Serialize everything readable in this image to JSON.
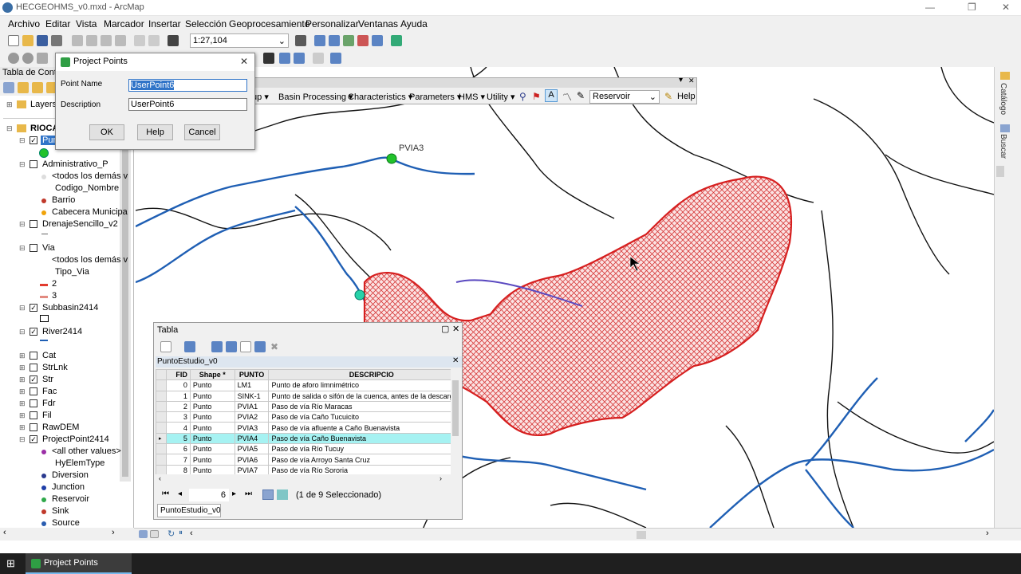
{
  "window": {
    "title": "HECGEOHMS_v0.mxd - ArcMap"
  },
  "menu": [
    "Archivo",
    "Editar",
    "Vista",
    "Marcador",
    "Insertar",
    "Selección",
    "Geoprocesamiento",
    "Personalizar",
    "Ventanas",
    "Ayuda"
  ],
  "toolbar": {
    "scale": "1:27,104"
  },
  "toc": {
    "title": "Tabla de Conte",
    "layers_label": "Layers",
    "root": "RIOCA",
    "pun": "Pun",
    "items": [
      "Administrativo_P",
      "<todos los demás v",
      "Codigo_Nombre",
      "Barrio",
      "Cabecera Municipa",
      "DrenajeSencillo_v2",
      "Via",
      "<todos los demás v",
      "Tipo_Via",
      "2",
      "3",
      "Subbasin2414",
      "River2414",
      "Cat",
      "StrLnk",
      "Str",
      "Fac",
      "Fdr",
      "Fil",
      "RawDEM",
      "ProjectPoint2414",
      "<all other values>",
      "HyElemType",
      "Diversion",
      "Junction",
      "Reservoir",
      "Sink",
      "Source"
    ]
  },
  "hydro": {
    "items": [
      "tup",
      "Basin Processing",
      "Characteristics",
      "Parameters",
      "HMS",
      "Utility"
    ],
    "reservoir": "Reservoir",
    "help": "Help"
  },
  "dialog": {
    "title": "Project Points",
    "point_name_label": "Point Name",
    "point_name_value": "UserPoint6",
    "description_label": "Description",
    "description_value": "UserPoint6",
    "ok": "OK",
    "help": "Help",
    "cancel": "Cancel"
  },
  "map": {
    "label_pvia3": "PVIA3"
  },
  "tabla": {
    "title": "Tabla",
    "subtitle": "PuntoEstudio_v0",
    "columns": [
      "FID",
      "Shape *",
      "PUNTO",
      "DESCRIPCIO"
    ],
    "rows": [
      [
        "0",
        "Punto",
        "LM1",
        "Punto de aforo limnimétrico"
      ],
      [
        "1",
        "Punto",
        "SINK-1",
        "Punto de salida o sifón de la cuenca, antes de la descarga"
      ],
      [
        "2",
        "Punto",
        "PVIA1",
        "Paso de vía Río Maracas"
      ],
      [
        "3",
        "Punto",
        "PVIA2",
        "Paso de vía Caño Tucuicito"
      ],
      [
        "4",
        "Punto",
        "PVIA3",
        "Paso de vía afluente a Caño Buenavista"
      ],
      [
        "5",
        "Punto",
        "PVIA4",
        "Paso de vía Caño Buenavista"
      ],
      [
        "6",
        "Punto",
        "PVIA5",
        "Paso de vía Río Tucuy"
      ],
      [
        "7",
        "Punto",
        "PVIA6",
        "Paso de vía Arroyo Santa Cruz"
      ],
      [
        "8",
        "Punto",
        "PVIA7",
        "Paso de vía Río Sororia"
      ]
    ],
    "selected_row": 5,
    "record": "6",
    "selection_text": "(1 de 9 Seleccionado)",
    "tab": "PuntoEstudio_v0"
  },
  "rightbar": {
    "catalog": "Catálogo",
    "search": "Buscar"
  },
  "taskbar": {
    "app": "Project Points"
  }
}
